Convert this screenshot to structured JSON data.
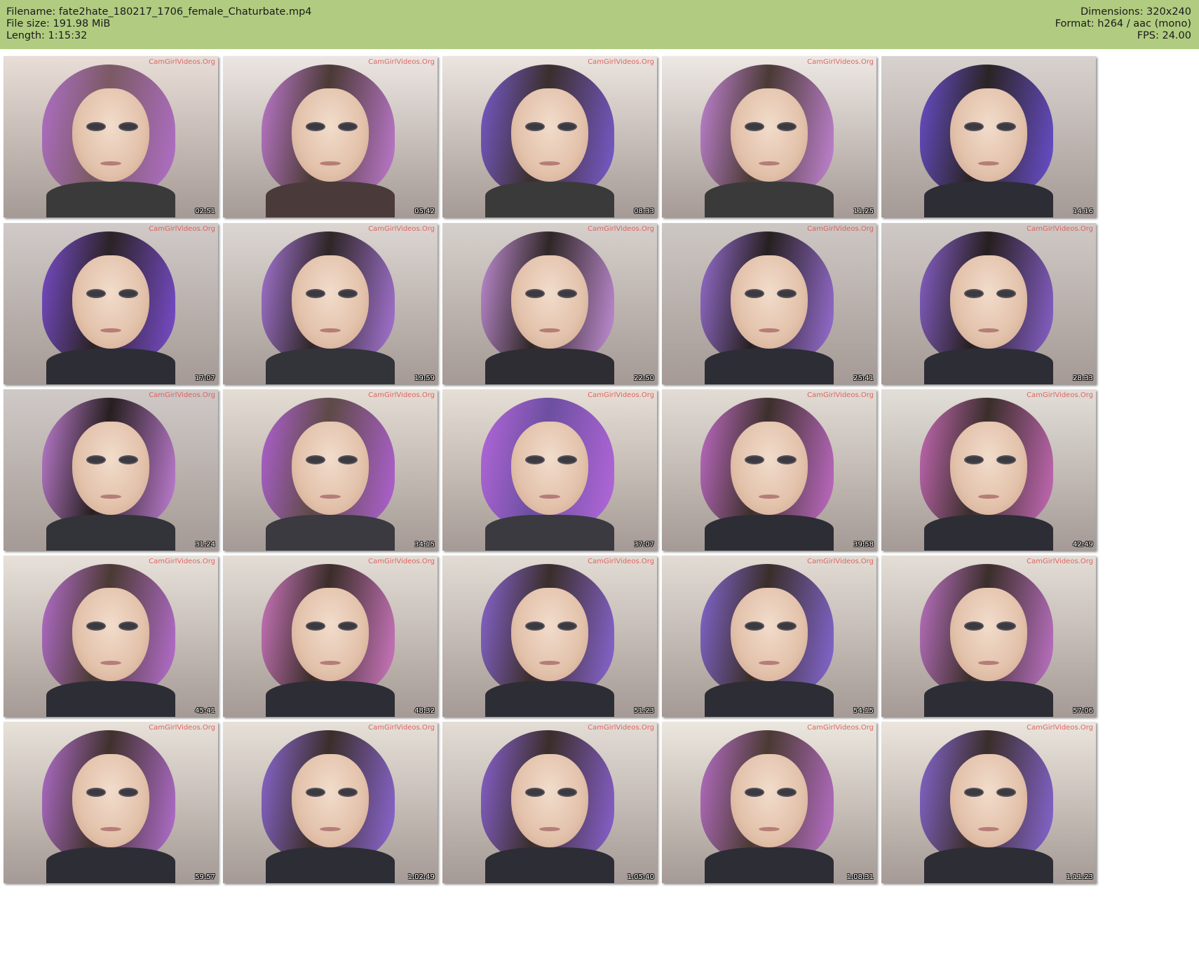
{
  "header": {
    "filename": "Filename: fate2hate_180217_1706_female_Chaturbate.mp4",
    "file_size": "File size: 191.98 MiB",
    "length": "Length: 1:15:32",
    "dimensions": "Dimensions: 320x240",
    "format": "Format: h264 / aac (mono)",
    "fps": "FPS: 24.00"
  },
  "thumbnails": [
    {
      "timestamp": "02:51",
      "watermark": "CamGirlVideos.Org",
      "background": "#e8ddd7",
      "hair": "#7a5a63",
      "hair_tint": "#b16fc9",
      "top": "#3a3a3a"
    },
    {
      "timestamp": "05:42",
      "watermark": "CamGirlVideos.Org",
      "background": "#ece6e2",
      "hair": "#4a3a35",
      "hair_tint": "#c07ad0",
      "top": "#4a3a3a"
    },
    {
      "timestamp": "08:33",
      "watermark": "CamGirlVideos.Org",
      "background": "#ebe4df",
      "hair": "#3a2f2c",
      "hair_tint": "#7a5bd0",
      "top": "#3a3a3a"
    },
    {
      "timestamp": "11:25",
      "watermark": "CamGirlVideos.Org",
      "background": "#eee8e4",
      "hair": "#4a3a35",
      "hair_tint": "#c485d6",
      "top": "#3a3a3a"
    },
    {
      "timestamp": "14:16",
      "watermark": "",
      "background": "#d8d2cf",
      "hair": "#2a2424",
      "hair_tint": "#6a4fd0",
      "top": "#2d2d35"
    },
    {
      "timestamp": "17:07",
      "watermark": "CamGirlVideos.Org",
      "background": "#d0cac8",
      "hair": "#2b2325",
      "hair_tint": "#7a4dd0",
      "top": "#2d2d35"
    },
    {
      "timestamp": "19:59",
      "watermark": "CamGirlVideos.Org",
      "background": "#dcd6d2",
      "hair": "#2e2626",
      "hair_tint": "#a776d8",
      "top": "#33333a"
    },
    {
      "timestamp": "22:50",
      "watermark": "CamGirlVideos.Org",
      "background": "#d6d0cc",
      "hair": "#2f2726",
      "hair_tint": "#c48fd8",
      "top": "#2d2d33"
    },
    {
      "timestamp": "25:41",
      "watermark": "CamGirlVideos.Org",
      "background": "#cdc7c4",
      "hair": "#262020",
      "hair_tint": "#9a70d6",
      "top": "#2d2d35"
    },
    {
      "timestamp": "28:33",
      "watermark": "CamGirlVideos.Org",
      "background": "#cfc9c6",
      "hair": "#261f1f",
      "hair_tint": "#8a62cf",
      "top": "#2d2d35"
    },
    {
      "timestamp": "31:24",
      "watermark": "CamGirlVideos.Org",
      "background": "#cfc9c7",
      "hair": "#261f1f",
      "hair_tint": "#c27fd6",
      "top": "#33333a"
    },
    {
      "timestamp": "34:15",
      "watermark": "CamGirlVideos.Org",
      "background": "#e4ddd4",
      "hair": "#5d4a45",
      "hair_tint": "#b161d6",
      "top": "#3a3a40"
    },
    {
      "timestamp": "37:07",
      "watermark": "CamGirlVideos.Org",
      "background": "#e6dfd6",
      "hair": "#6c4fa0",
      "hair_tint": "#b467db",
      "top": "#3a3a40"
    },
    {
      "timestamp": "39:58",
      "watermark": "CamGirlVideos.Org",
      "background": "#e2dcd5",
      "hair": "#3d302c",
      "hair_tint": "#c26cc8",
      "top": "#2d2d35"
    },
    {
      "timestamp": "42:49",
      "watermark": "CamGirlVideos.Org",
      "background": "#e2ded8",
      "hair": "#3a2e2a",
      "hair_tint": "#c86ab8",
      "top": "#2d2d35"
    },
    {
      "timestamp": "45:41",
      "watermark": "CamGirlVideos.Org",
      "background": "#e7e1da",
      "hair": "#4a3a33",
      "hair_tint": "#b86fd2",
      "top": "#2d2d35"
    },
    {
      "timestamp": "48:32",
      "watermark": "CamGirlVideos.Org",
      "background": "#e3ddd6",
      "hair": "#3a2d29",
      "hair_tint": "#d078c2",
      "top": "#2d2d35"
    },
    {
      "timestamp": "51:23",
      "watermark": "CamGirlVideos.Org",
      "background": "#e2dcd5",
      "hair": "#3a2e2a",
      "hair_tint": "#8a66d6",
      "top": "#2d2d35"
    },
    {
      "timestamp": "54:15",
      "watermark": "CamGirlVideos.Org",
      "background": "#e2dcd5",
      "hair": "#3a2e2a",
      "hair_tint": "#8668d6",
      "top": "#2d2d35"
    },
    {
      "timestamp": "57:06",
      "watermark": "CamGirlVideos.Org",
      "background": "#e4ded7",
      "hair": "#3a2e2a",
      "hair_tint": "#c073c8",
      "top": "#2d2d35"
    },
    {
      "timestamp": "59:57",
      "watermark": "CamGirlVideos.Org",
      "background": "#e7e1d9",
      "hair": "#3f312c",
      "hair_tint": "#b46fd0",
      "top": "#2d2d35"
    },
    {
      "timestamp": "1:02:49",
      "watermark": "CamGirlVideos.Org",
      "background": "#e6e0d8",
      "hair": "#3a2e2a",
      "hair_tint": "#8d68d6",
      "top": "#2d2d35"
    },
    {
      "timestamp": "1:05:40",
      "watermark": "CamGirlVideos.Org",
      "background": "#e3ddd6",
      "hair": "#3a2e2a",
      "hair_tint": "#8a62d4",
      "top": "#2d2d35"
    },
    {
      "timestamp": "1:08:31",
      "watermark": "CamGirlVideos.Org",
      "background": "#ece7de",
      "hair": "#4a3a33",
      "hair_tint": "#b96fc9",
      "top": "#2d2d35"
    },
    {
      "timestamp": "1:11:23",
      "watermark": "CamGirlVideos.Org",
      "background": "#ebe5dd",
      "hair": "#3a2e2a",
      "hair_tint": "#8767d4",
      "top": "#2d2d35"
    }
  ]
}
